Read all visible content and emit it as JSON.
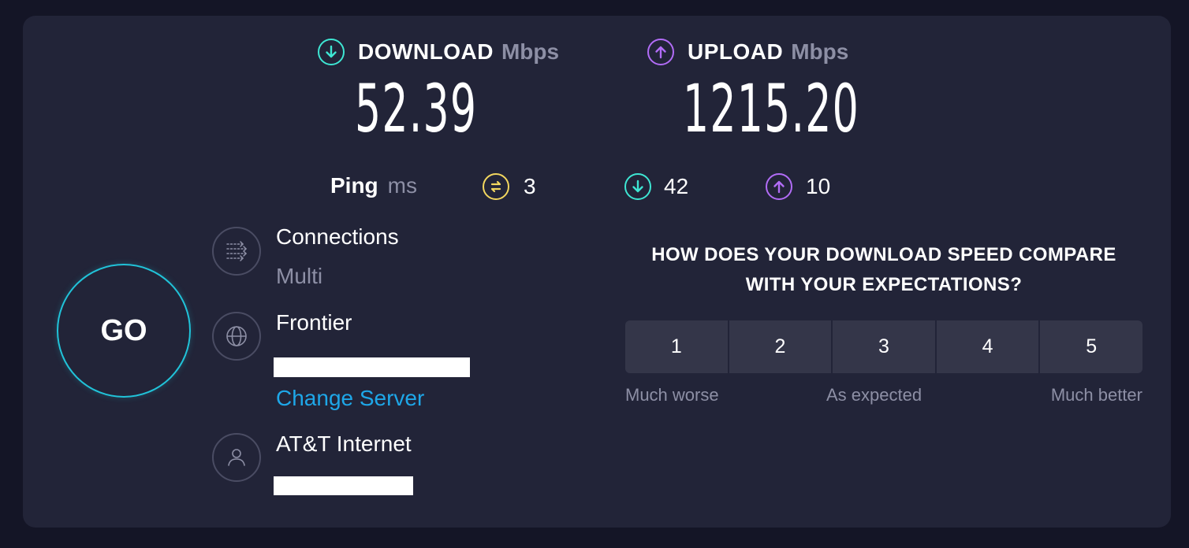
{
  "download": {
    "label": "DOWNLOAD",
    "unit": "Mbps",
    "value": "52.39",
    "color": "#3ee6d3"
  },
  "upload": {
    "label": "UPLOAD",
    "unit": "Mbps",
    "value": "1215.20",
    "color": "#b16cf6"
  },
  "ping": {
    "label": "Ping",
    "unit": "ms",
    "idle": "3",
    "download": "42",
    "upload": "10",
    "idle_color": "#f3d75f"
  },
  "go_button": {
    "label": "GO",
    "ring_color": "#21c3d9"
  },
  "connections": {
    "title": "Connections",
    "value": "Multi"
  },
  "server": {
    "name": "Frontier",
    "change_label": "Change Server"
  },
  "provider": {
    "name": "AT&T Internet"
  },
  "survey": {
    "question": "HOW DOES YOUR DOWNLOAD SPEED COMPARE WITH YOUR EXPECTATIONS?",
    "options": [
      "1",
      "2",
      "3",
      "4",
      "5"
    ],
    "low_label": "Much worse",
    "mid_label": "As expected",
    "high_label": "Much better"
  }
}
